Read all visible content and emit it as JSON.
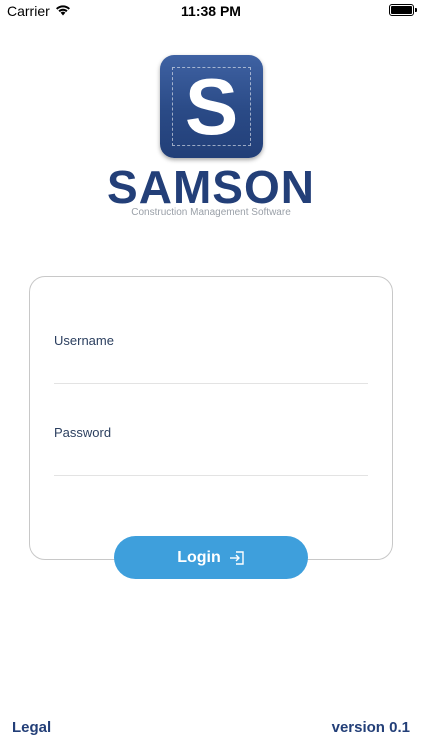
{
  "status_bar": {
    "carrier": "Carrier",
    "time": "11:38 PM",
    "wifi_icon": "wifi-icon",
    "battery_icon": "battery-icon"
  },
  "brand": {
    "logo_letter": "S",
    "name": "SAMSON",
    "tagline": "Construction Management Software",
    "colors": {
      "primary": "#233f78",
      "accent": "#3e9fdc"
    }
  },
  "login_form": {
    "username_label": "Username",
    "username_value": "",
    "password_label": "Password",
    "password_value": "",
    "login_label": "Login",
    "login_icon": "sign-in-icon"
  },
  "footer": {
    "legal_label": "Legal",
    "version_text": "version 0.1"
  }
}
